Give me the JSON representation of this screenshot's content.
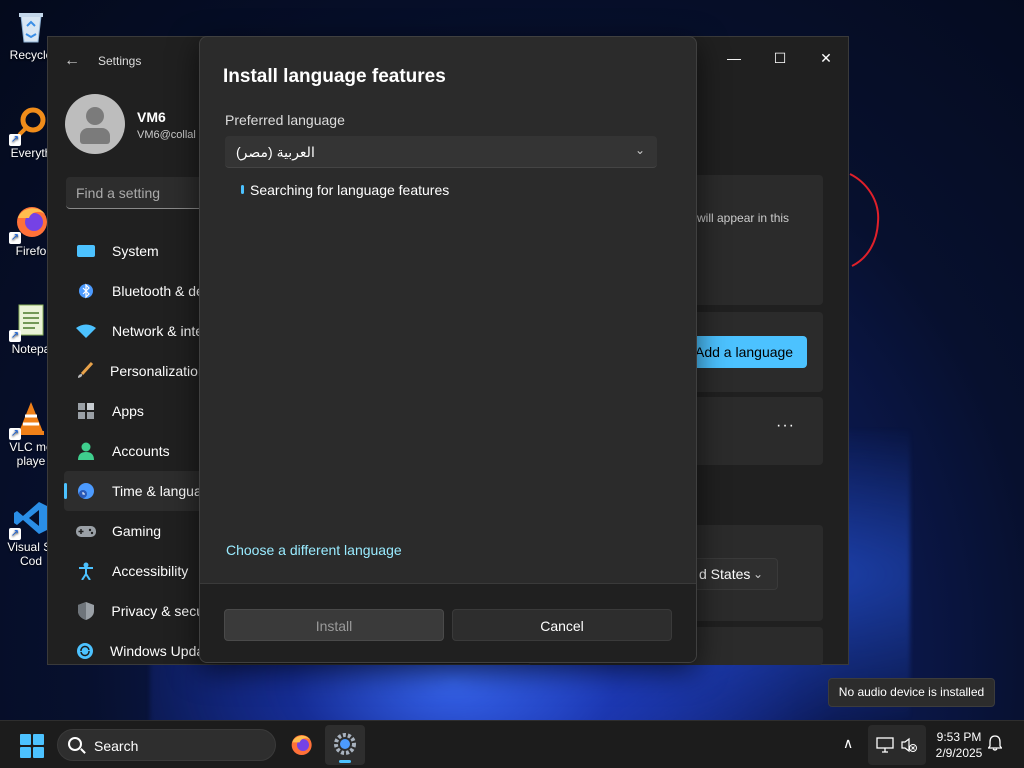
{
  "desktop": {
    "icons": [
      {
        "label": "Recycle",
        "icon": "recycle-bin-icon"
      },
      {
        "label": "Everyth",
        "icon": "everything-search-icon"
      },
      {
        "label": "Firefo",
        "icon": "firefox-icon"
      },
      {
        "label": "Notepa",
        "icon": "notepad-icon"
      },
      {
        "label": "VLC me",
        "label2": "playe",
        "icon": "vlc-icon"
      },
      {
        "label": "Visual St",
        "label2": "Cod",
        "icon": "vscode-icon"
      }
    ]
  },
  "settings": {
    "app_title": "Settings",
    "window_controls": {
      "minimize": "—",
      "maximize": "☐",
      "close": "✕"
    },
    "user": {
      "name": "VM6",
      "email": "VM6@collal"
    },
    "search_placeholder": "Find a setting",
    "nav": [
      {
        "label": "System",
        "icon": "system-icon",
        "color": "#4cc2ff"
      },
      {
        "label": "Bluetooth & de",
        "icon": "bluetooth-icon",
        "color": "#4c9bff"
      },
      {
        "label": "Network & inte",
        "icon": "wifi-icon",
        "color": "#4cc2ff"
      },
      {
        "label": "Personalization",
        "icon": "brush-icon",
        "color": "#e8a24a"
      },
      {
        "label": "Apps",
        "icon": "apps-icon",
        "color": "#9aa0a6"
      },
      {
        "label": "Accounts",
        "icon": "accounts-icon",
        "color": "#3fcf8e"
      },
      {
        "label": "Time & langua",
        "icon": "time-language-icon",
        "color": "#4c9bff",
        "active": true
      },
      {
        "label": "Gaming",
        "icon": "gaming-icon",
        "color": "#9aa0a6"
      },
      {
        "label": "Accessibility",
        "icon": "accessibility-icon",
        "color": "#4cc2ff"
      },
      {
        "label": "Privacy & secu",
        "icon": "shield-icon",
        "color": "#9aa0a6"
      },
      {
        "label": "Windows Upda",
        "icon": "windows-update-icon",
        "color": "#4cc2ff"
      }
    ],
    "content": {
      "hint_text": "will appear in this",
      "add_language_label": "Add a language",
      "more_label": "···",
      "region_value": "d States",
      "region_chevron": "⌄"
    }
  },
  "dialog": {
    "title": "Install language features",
    "preferred_label": "Preferred language",
    "preferred_value": "العربية (مصر)",
    "chevron": "⌄",
    "status": "Searching for language features",
    "choose_link": "Choose a different language",
    "install_label": "Install",
    "cancel_label": "Cancel"
  },
  "tooltip": "No audio device is installed",
  "taskbar": {
    "search_label": "Search",
    "apps": [
      {
        "icon": "firefox-icon"
      },
      {
        "icon": "settings-icon",
        "active": true
      }
    ],
    "tray_up": "∧",
    "time": "9:53 PM",
    "date": "2/9/2025",
    "bell": "🔔"
  },
  "colors": {
    "accent": "#4cc2ff",
    "link": "#99ebff",
    "scribble": "#e0202a"
  }
}
